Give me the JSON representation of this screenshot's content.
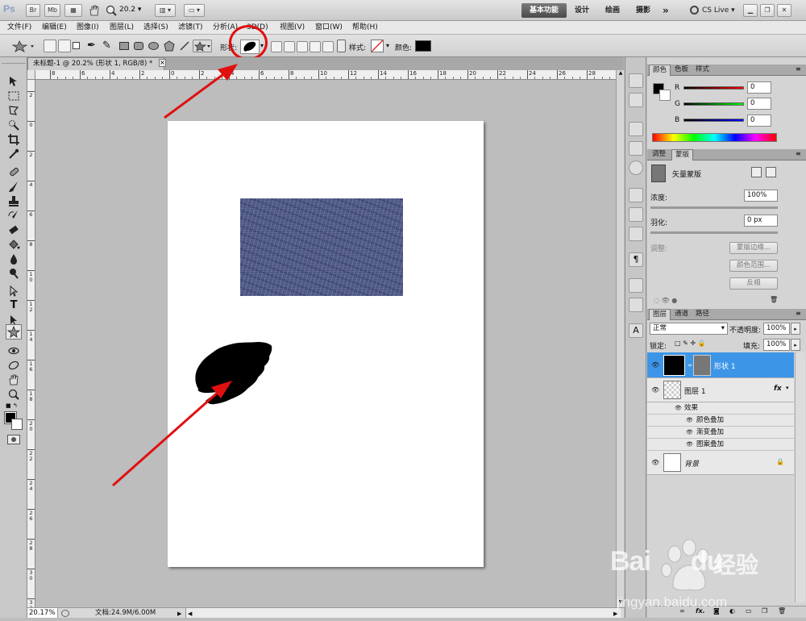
{
  "app": {
    "logo": "Ps",
    "bridge_btn": "Br",
    "minibridge_btn": "Mb",
    "zoom_value": "20.2",
    "workspaces": {
      "active": "基本功能",
      "design": "设计",
      "painting": "绘画",
      "photography": "摄影",
      "more": "»"
    },
    "cslive": "CS Live"
  },
  "menu": [
    "文件(F)",
    "编辑(E)",
    "图像(I)",
    "图层(L)",
    "选择(S)",
    "滤镜(T)",
    "分析(A)",
    "3D(D)",
    "视图(V)",
    "窗口(W)",
    "帮助(H)"
  ],
  "options": {
    "shape_label": "形状:",
    "style_label": "样式:",
    "color_label": "颜色:",
    "color_value": "#000000"
  },
  "document": {
    "tab_title": "未标题-1 @ 20.2% (形状 1, RGB/8) *",
    "close": "×"
  },
  "ruler": {
    "h_ticks": [
      "8",
      "6",
      "4",
      "2",
      "0",
      "2",
      "4",
      "6",
      "8",
      "10",
      "12",
      "14",
      "16",
      "18",
      "20",
      "22",
      "24",
      "26",
      "28"
    ],
    "v_ticks": [
      "2",
      "0",
      "2",
      "4",
      "6",
      "8",
      "1\n0",
      "1\n2",
      "1\n4",
      "1\n6",
      "1\n8",
      "2\n0",
      "2\n2",
      "2\n4",
      "2\n6",
      "2\n8",
      "3\n0",
      "3\n2"
    ]
  },
  "status": {
    "zoom": "20.17%",
    "doc_info": "文档:24.9M/6.00M"
  },
  "color_panel": {
    "tabs": [
      "颜色",
      "色板",
      "样式"
    ],
    "r_label": "R",
    "g_label": "G",
    "b_label": "B",
    "r_value": "0",
    "g_value": "0",
    "b_value": "0"
  },
  "masks_panel": {
    "tabs": [
      "调整",
      "蒙版"
    ],
    "title": "矢量蒙版",
    "density_label": "浓度:",
    "density_value": "100%",
    "feather_label": "羽化:",
    "feather_value": "0 px",
    "refine_label": "调整:",
    "mask_edge_btn": "蒙版边缘...",
    "color_range_btn": "颜色范围...",
    "invert_btn": "反相"
  },
  "layers_panel": {
    "tabs": [
      "图层",
      "通道",
      "路径"
    ],
    "blend_mode": "正常",
    "opacity_label": "不透明度:",
    "opacity_value": "100%",
    "lock_label": "锁定:",
    "fill_label": "填充:",
    "fill_value": "100%",
    "layers": [
      {
        "name": "形状 1",
        "selected": true
      },
      {
        "name": "图层 1",
        "fx": "fx"
      },
      {
        "name": "背景",
        "locked": true
      }
    ],
    "effects_label": "效果",
    "effects": [
      "颜色叠加",
      "渐变叠加",
      "图案叠加"
    ]
  },
  "watermark": {
    "brand_a": "Bai",
    "brand_b": "du",
    "brand_cn": "经验",
    "url": "jingyan.baidu.com"
  },
  "colors": {
    "annotation": "#e01010",
    "selected_layer": "#3d95e8",
    "texture": "#4d5784"
  }
}
